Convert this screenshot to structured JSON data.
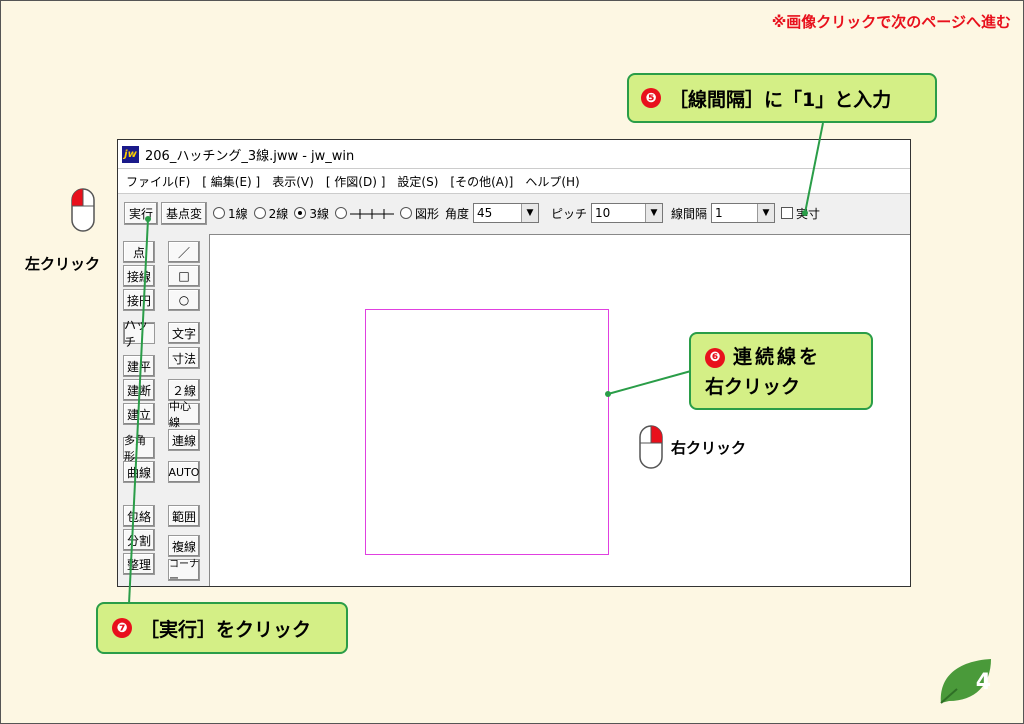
{
  "note": "※画像クリックで次のページへ進む",
  "window": {
    "title": "206_ハッチング_3線.jww - jw_win",
    "icon_text": "jw",
    "menu": [
      "ファイル(F)",
      "[ 編集(E) ]",
      "表示(V)",
      "[ 作図(D) ]",
      "設定(S)",
      "[その他(A)]",
      "ヘルプ(H)"
    ]
  },
  "toolbar": {
    "exec": "実行",
    "kiten": "基点変",
    "r1": "1線",
    "r2": "2線",
    "r3": "3線",
    "r5": "図形",
    "angle_label": "角度",
    "angle_value": "45",
    "pitch_label": "ピッチ",
    "pitch_value": "10",
    "spacing_label": "線間隔",
    "spacing_value": "1",
    "jissun": "実寸"
  },
  "left_tools": {
    "col1": [
      "点",
      "接線",
      "接円",
      "ハッチ",
      "建平",
      "建断",
      "建立",
      "多角形",
      "曲線",
      "包絡",
      "分割",
      "整理"
    ],
    "col2": [
      "／",
      "□",
      "○",
      "文字",
      "寸法",
      "２線",
      "中心線",
      "連線",
      "AUTO",
      "範囲",
      "複線",
      "コーナー"
    ]
  },
  "callouts": {
    "c5": {
      "num": "❺",
      "text": "［線間隔］に「1」と入力"
    },
    "c6": {
      "num": "❻",
      "line1": "連続線を",
      "line2": "右クリック"
    },
    "c7": {
      "num": "❼",
      "text": "［実行］をクリック"
    }
  },
  "labels": {
    "left_click": "左クリック",
    "right_click": "右クリック"
  },
  "page_number": "4",
  "colors": {
    "callout_fill": "#d4ef86",
    "callout_border": "#2a9d48",
    "accent_red": "#e8101c",
    "rect": "#e040e0"
  }
}
